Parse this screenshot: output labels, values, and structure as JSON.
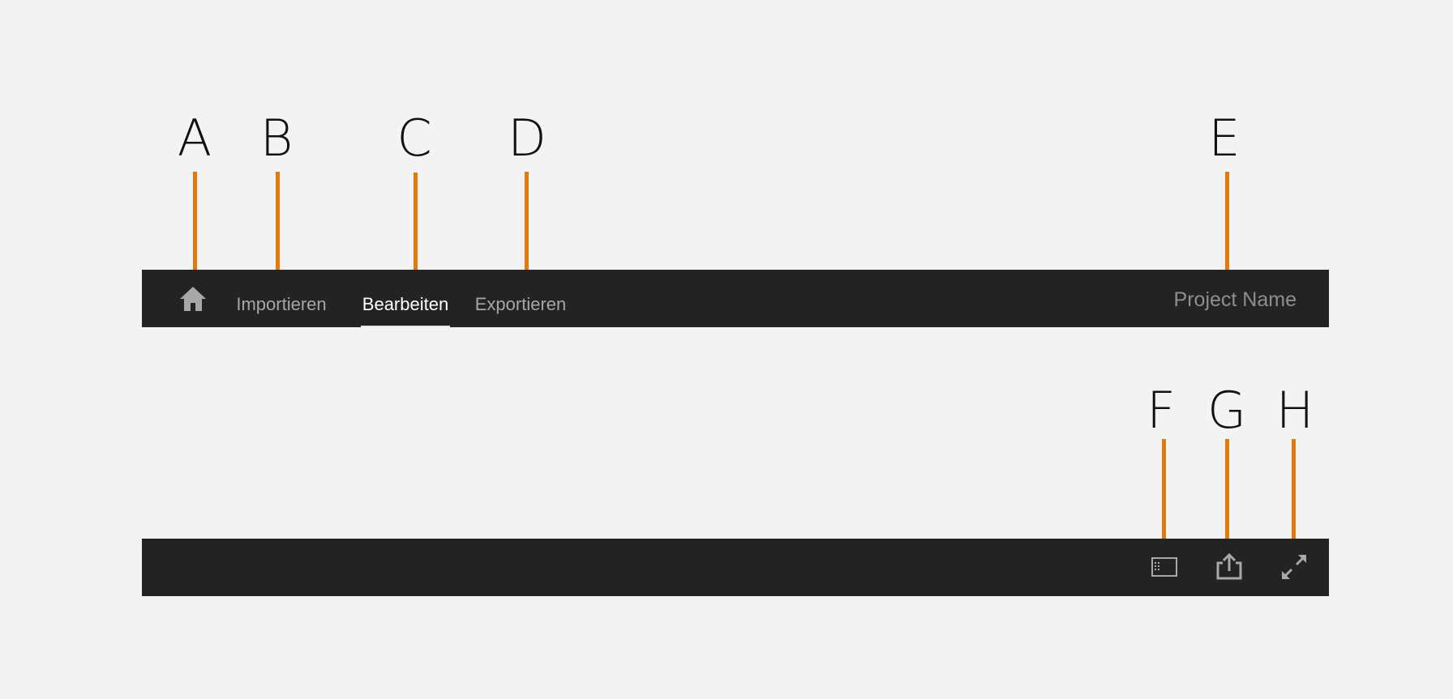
{
  "callouts": {
    "a": "A",
    "b": "B",
    "c": "C",
    "d": "D",
    "e": "E",
    "f": "F",
    "g": "G",
    "h": "H"
  },
  "top_bar": {
    "home_icon": "home-icon",
    "tabs": [
      {
        "label": "Importieren",
        "active": false
      },
      {
        "label": "Bearbeiten",
        "active": true
      },
      {
        "label": "Exportieren",
        "active": false
      }
    ],
    "project_name": "Project Name"
  },
  "bottom_bar": {
    "tools": [
      {
        "icon": "panel-toggle-icon"
      },
      {
        "icon": "share-icon"
      },
      {
        "icon": "fullscreen-icon"
      }
    ]
  },
  "colors": {
    "background": "#f3f3f3",
    "bar": "#232323",
    "callout_line": "#e07a10",
    "tab_inactive": "#a6a6a6",
    "tab_active": "#ffffff",
    "project_name": "#8e8e8e",
    "icon": "#a8a8a8"
  }
}
